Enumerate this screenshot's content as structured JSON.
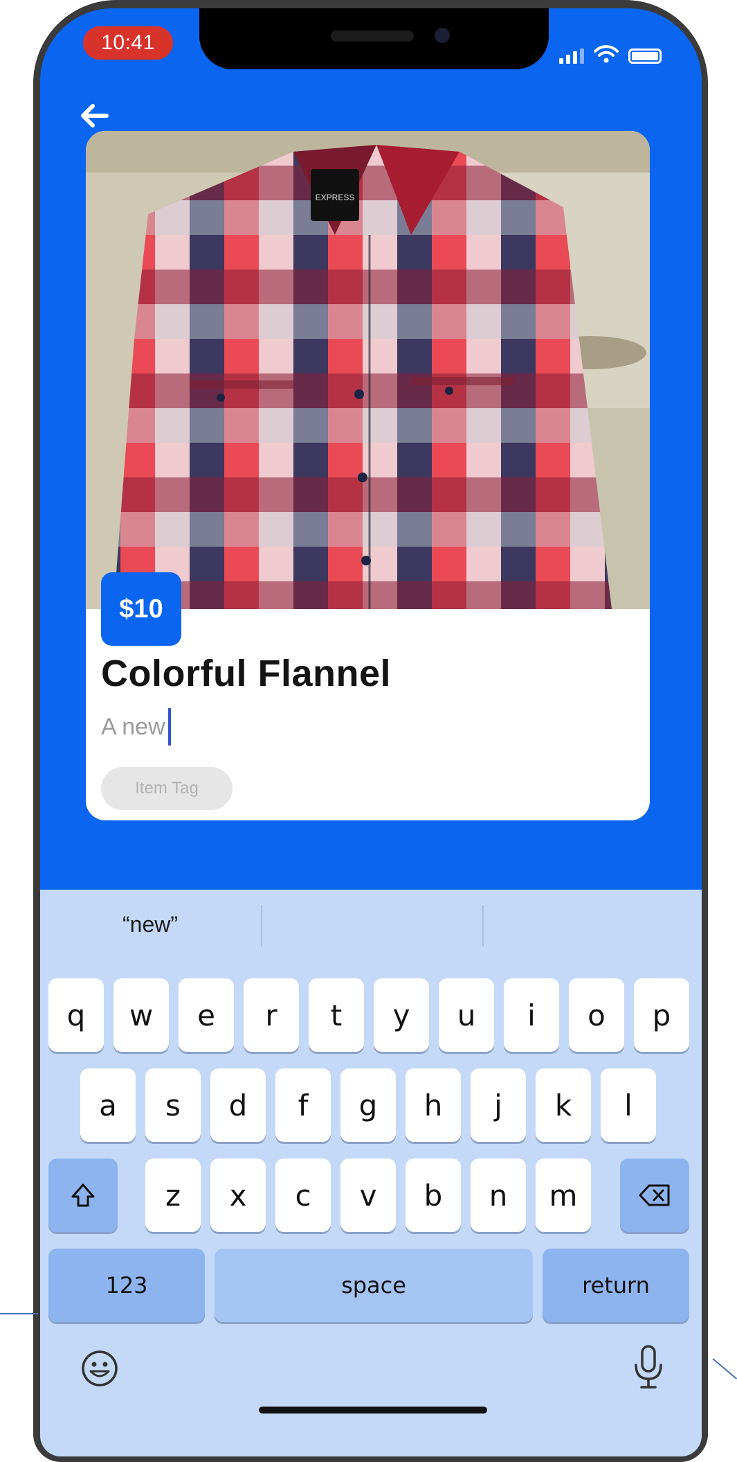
{
  "status_bar": {
    "time": "10:41",
    "time_pill_color": "#d8332b"
  },
  "nav": {
    "back_icon": "arrow-left-icon"
  },
  "listing": {
    "price": "$10",
    "title": "Colorful Flannel",
    "description_value": "A new",
    "tag_placeholder": "Item Tag",
    "photo_subject": "red-white-blue-plaid-flannel-shirt"
  },
  "keyboard": {
    "suggestions": [
      "“new”",
      "",
      ""
    ],
    "row1": [
      "q",
      "w",
      "e",
      "r",
      "t",
      "y",
      "u",
      "i",
      "o",
      "p"
    ],
    "row2": [
      "a",
      "s",
      "d",
      "f",
      "g",
      "h",
      "j",
      "k",
      "l"
    ],
    "row3": [
      "z",
      "x",
      "c",
      "v",
      "b",
      "n",
      "m"
    ],
    "numbers_label": "123",
    "space_label": "space",
    "return_label": "return",
    "shift_icon": "shift-icon",
    "delete_icon": "delete-icon",
    "emoji_icon": "emoji-icon",
    "mic_icon": "microphone-icon"
  },
  "colors": {
    "primary": "#0a66f0",
    "keyboard_bg": "#c4d9f7",
    "modifier_key": "#8db4ef",
    "caret": "#3454d1"
  }
}
